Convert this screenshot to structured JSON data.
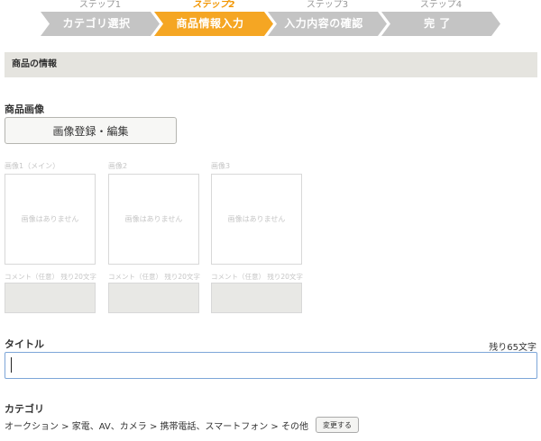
{
  "steps": [
    {
      "num": "ステップ1",
      "label": "カテゴリ選択",
      "state": "done"
    },
    {
      "num": "ステップ2",
      "label": "商品情報入力",
      "state": "active"
    },
    {
      "num": "ステップ3",
      "label": "入力内容の確認",
      "state": "todo"
    },
    {
      "num": "ステップ4",
      "label": "完 了",
      "state": "todo"
    }
  ],
  "colors": {
    "step_active": "#f5a623",
    "step_inactive": "#c4c4c4",
    "step_number_active": "#f29600",
    "section_bg": "#e5e4df",
    "input_border_focus": "#7da6d8"
  },
  "section": {
    "title": "商品の情報"
  },
  "images": {
    "heading": "商品画像",
    "edit_button": "画像登録・編集",
    "slots": [
      {
        "label": "画像1（メイン）",
        "placeholder": "画像はありません",
        "comment_label": "コメント（任意） 残り20文字"
      },
      {
        "label": "画像2",
        "placeholder": "画像はありません",
        "comment_label": "コメント（任意） 残り20文字"
      },
      {
        "label": "画像3",
        "placeholder": "画像はありません",
        "comment_label": "コメント（任意） 残り20文字"
      }
    ]
  },
  "title_field": {
    "label": "タイトル",
    "remaining": "残り65文字",
    "value": ""
  },
  "category": {
    "label": "カテゴリ",
    "path": "オークション > 家電、AV、カメラ > 携帯電話、スマートフォン > その他",
    "change_button": "変更する"
  }
}
